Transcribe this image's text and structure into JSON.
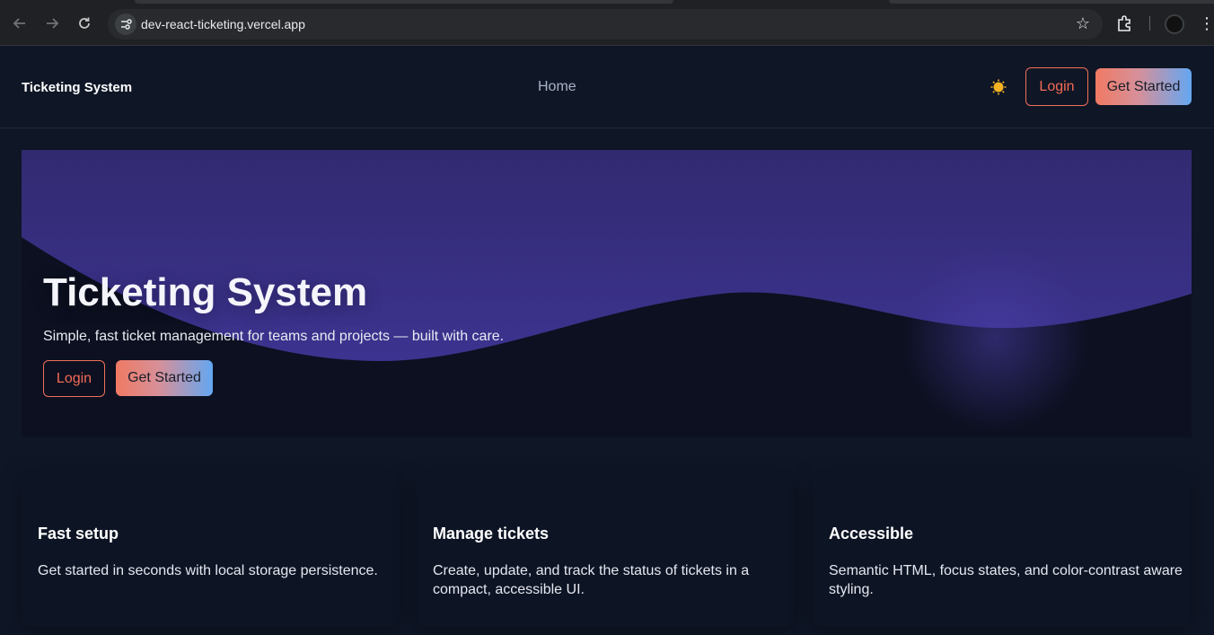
{
  "browser": {
    "url": "dev-react-ticketing.vercel.app"
  },
  "header": {
    "brand": "Ticketing System",
    "nav_home": "Home",
    "login_label": "Login",
    "get_started_label": "Get Started"
  },
  "hero": {
    "title": "Ticketing System",
    "subtitle": "Simple, fast ticket management for teams and projects — built with care.",
    "login_label": "Login",
    "get_started_label": "Get Started"
  },
  "features": [
    {
      "title": "Fast setup",
      "text": "Get started in seconds with local storage persistence."
    },
    {
      "title": "Manage tickets",
      "text": "Create, update, and track the status of tickets in a compact, accessible UI."
    },
    {
      "title": "Accessible",
      "text": "Semantic HTML, focus states, and color-contrast aware styling."
    }
  ],
  "colors": {
    "accent_orange": "#f46b55",
    "accent_blue": "#63a7f2",
    "hero_purple": "#3b2f8a",
    "page_bg": "#0f1626"
  }
}
